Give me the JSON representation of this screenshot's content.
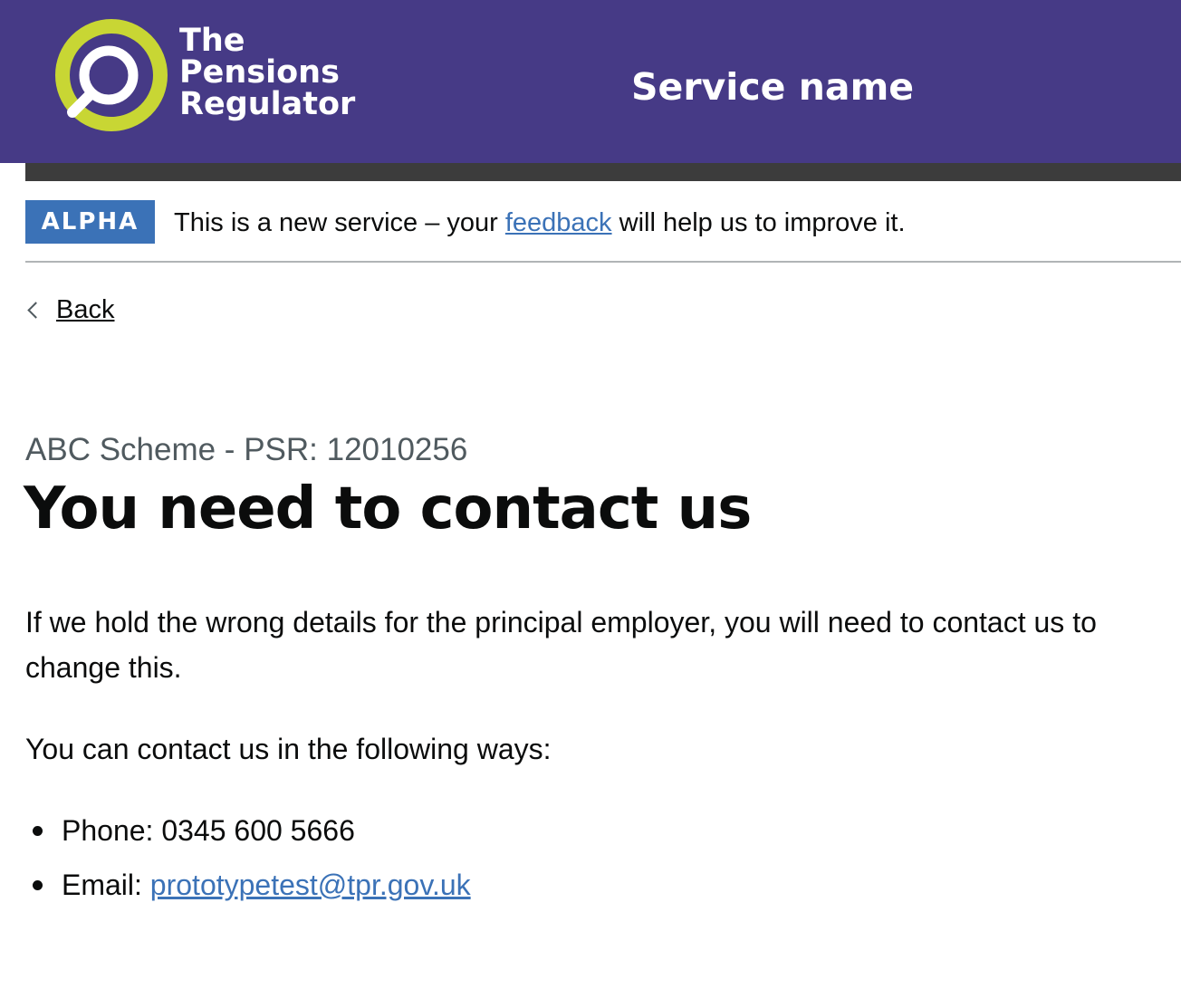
{
  "header": {
    "logo_lines": [
      "The",
      "Pensions",
      "Regulator"
    ],
    "service_name": "Service name",
    "colors": {
      "header_bg": "#463a86",
      "logo_ring": "#c8d634",
      "stripe": "#3c3c3c"
    }
  },
  "phase_banner": {
    "tag": "ALPHA",
    "text_before": "This is a new service – your ",
    "link_text": "feedback",
    "text_after": " will help us to improve it.",
    "tag_color": "#3b72b7"
  },
  "back_link": {
    "label": "Back",
    "icon": "chevron-left-icon"
  },
  "main": {
    "caption": "ABC Scheme - PSR: 12010256",
    "heading": "You need to contact us",
    "paragraph_1": "If we hold the wrong details for the principal employer, you will need to contact us to change this.",
    "paragraph_2": "You can contact us in the following ways:",
    "contacts": {
      "phone_label": "Phone: ",
      "phone_value": "0345 600 5666",
      "email_label": "Email: ",
      "email_value": "prototypetest@tpr.gov.uk"
    }
  }
}
